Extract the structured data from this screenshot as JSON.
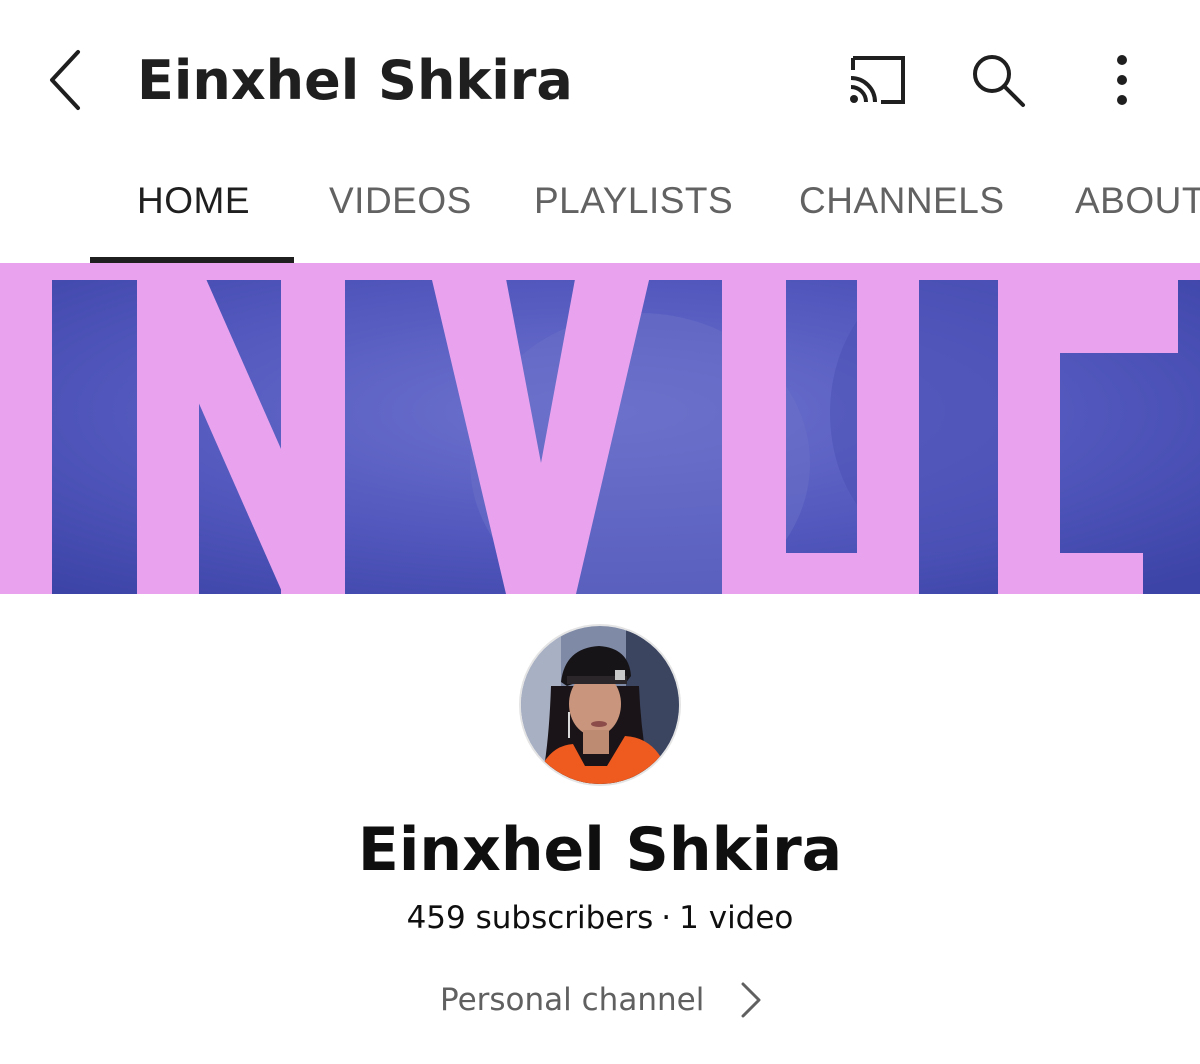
{
  "app_bar": {
    "title": "Einxhel Shkira",
    "icons": [
      "back-arrow-icon",
      "cast-icon",
      "search-icon",
      "more-vertical-icon"
    ]
  },
  "tabs": [
    {
      "label": "HOME",
      "active": true
    },
    {
      "label": "VIDEOS",
      "active": false
    },
    {
      "label": "PLAYLISTS",
      "active": false
    },
    {
      "label": "CHANNELS",
      "active": false
    },
    {
      "label": "ABOUT",
      "active": false
    }
  ],
  "channel": {
    "name": "Einxhel Shkira",
    "subscribers": "459 subscribers",
    "separator": "·",
    "videos": "1 video",
    "personal_channel_label": "Personal channel"
  },
  "colors": {
    "text_primary": "#1f1f1f",
    "text_secondary": "#606060",
    "banner_pink": "#e9a3ee",
    "banner_blue": "#4e56b8"
  }
}
